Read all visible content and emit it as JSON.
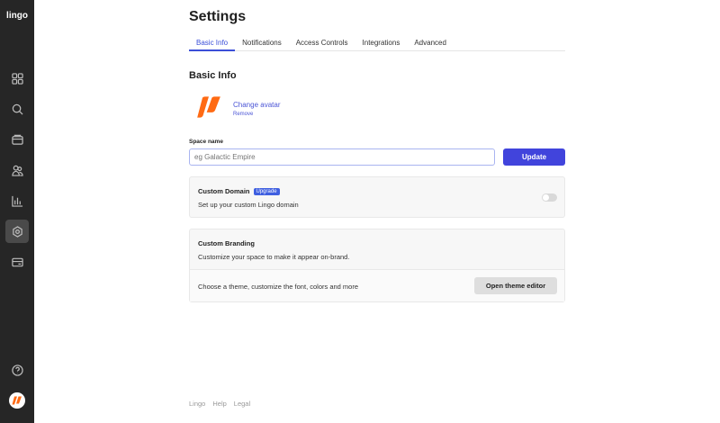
{
  "sidebar": {
    "logo": "lingo",
    "items": [
      "dashboard",
      "search",
      "archive",
      "users",
      "analytics",
      "settings",
      "billing"
    ],
    "active": "settings"
  },
  "page": {
    "title": "Settings"
  },
  "tabs": [
    {
      "label": "Basic Info"
    },
    {
      "label": "Notifications"
    },
    {
      "label": "Access Controls"
    },
    {
      "label": "Integrations"
    },
    {
      "label": "Advanced"
    }
  ],
  "basic": {
    "heading": "Basic Info",
    "change_avatar": "Change avatar",
    "remove": "Remove",
    "space_label": "Space name",
    "space_placeholder": "eg Galactic Empire",
    "space_value": "",
    "update": "Update"
  },
  "domain": {
    "title": "Custom Domain",
    "badge": "Upgrade",
    "desc": "Set up your custom Lingo domain",
    "enabled": false
  },
  "branding": {
    "title": "Custom Branding",
    "desc": "Customize your space to make it appear on-brand.",
    "row": "Choose a theme, customize the font, colors and more",
    "button": "Open theme editor"
  },
  "footer": [
    "Lingo",
    "Help",
    "Legal"
  ],
  "colors": {
    "accent": "#4144dc",
    "brand": "#ff6a13",
    "sidebar": "#262626"
  }
}
